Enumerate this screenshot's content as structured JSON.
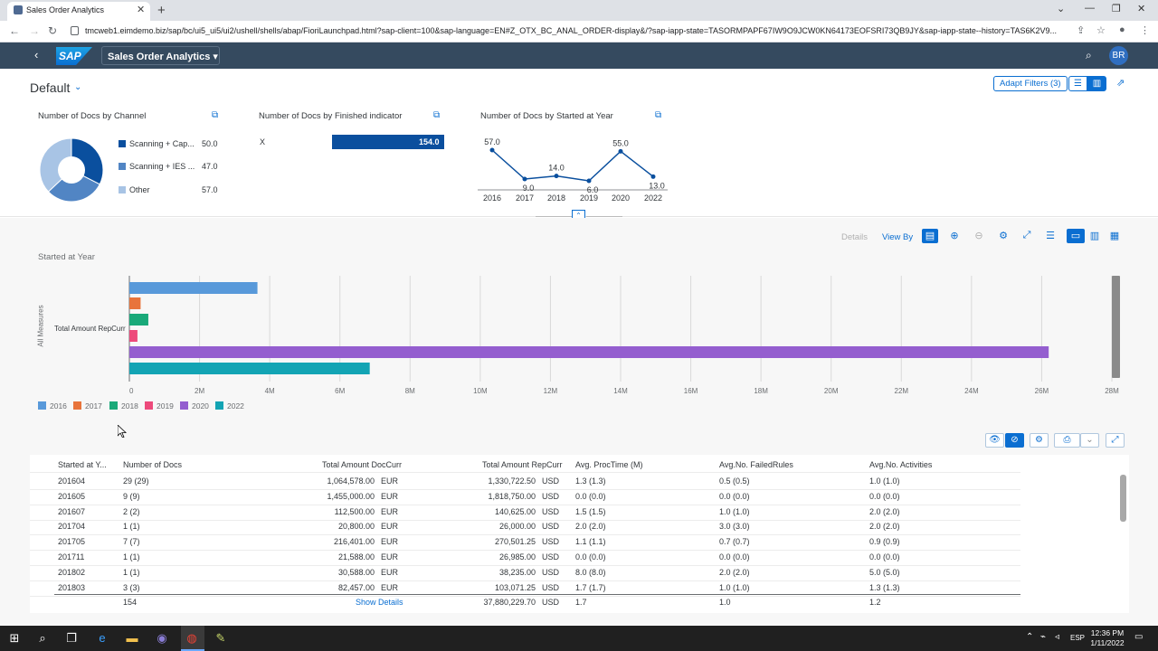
{
  "browser": {
    "tab_title": "Sales Order Analytics",
    "url": "tmcweb1.eimdemo.biz/sap/bc/ui5_ui5/ui2/ushell/shells/abap/FioriLaunchpad.html?sap-client=100&sap-language=EN#Z_OTX_BC_ANAL_ORDER-display&/?sap-iapp-state=TASORMPAPF67IW9O9JCW0KN64173EOFSRI73QB9JY&sap-iapp-state--history=TAS6K2V9..."
  },
  "shell": {
    "logo": "SAP",
    "app_title": "Sales Order Analytics ▾",
    "avatar": "BR"
  },
  "header": {
    "variant": "Default",
    "adapt_filters": "Adapt Filters (3)"
  },
  "cards": {
    "channel": {
      "title": "Number of Docs by Channel",
      "legend": [
        {
          "label": "Scanning + Cap...",
          "value": "50.0",
          "color": "#0a4f9e"
        },
        {
          "label": "Scanning + IES ...",
          "value": "47.0",
          "color": "#5185c4"
        },
        {
          "label": "Other",
          "value": "57.0",
          "color": "#a8c4e5"
        }
      ]
    },
    "finished": {
      "title": "Number of Docs by Finished indicator",
      "category": "X",
      "value": "154.0"
    },
    "started": {
      "title": "Number of Docs by Started at Year",
      "points": [
        {
          "year": "2016",
          "value": 57,
          "label": "57.0"
        },
        {
          "year": "2017",
          "value": 9,
          "label": "9.0"
        },
        {
          "year": "2018",
          "value": 14,
          "label": "14.0"
        },
        {
          "year": "2019",
          "value": 6,
          "label": "6.0"
        },
        {
          "year": "2020",
          "value": 55,
          "label": "55.0"
        },
        {
          "year": "2022",
          "value": 13,
          "label": "13.0"
        }
      ]
    }
  },
  "toolbar": {
    "details": "Details",
    "view_by": "View By"
  },
  "chart_data": {
    "type": "bar",
    "title": "Started at Year",
    "ylabel": "All Measures",
    "category": "Total Amount RepCurr",
    "xlim": [
      0,
      28000000
    ],
    "ticks": [
      "0",
      "2M",
      "4M",
      "6M",
      "8M",
      "10M",
      "12M",
      "14M",
      "16M",
      "18M",
      "20M",
      "22M",
      "24M",
      "26M",
      "28M"
    ],
    "series": [
      {
        "name": "2016",
        "value": 3650000,
        "color": "#5899da"
      },
      {
        "name": "2017",
        "value": 320000,
        "color": "#e8743b"
      },
      {
        "name": "2018",
        "value": 540000,
        "color": "#19a979"
      },
      {
        "name": "2019",
        "value": 230000,
        "color": "#ed4a7b"
      },
      {
        "name": "2020",
        "value": 26200000,
        "color": "#945ecf"
      },
      {
        "name": "2022",
        "value": 6850000,
        "color": "#13a4b4"
      }
    ]
  },
  "table": {
    "columns": [
      "Started at Y...",
      "Number of Docs",
      "Total Amount DocCurr",
      "Total Amount RepCurr",
      "Avg. ProcTime (M)",
      "Avg.No. FailedRules",
      "Avg.No. Activities"
    ],
    "rows": [
      [
        "201604",
        "29 (29)",
        "1,064,578.00",
        "EUR",
        "1,330,722.50",
        "USD",
        "1.3 (1.3)",
        "0.5 (0.5)",
        "1.0 (1.0)"
      ],
      [
        "201605",
        "9 (9)",
        "1,455,000.00",
        "EUR",
        "1,818,750.00",
        "USD",
        "0.0 (0.0)",
        "0.0 (0.0)",
        "0.0 (0.0)"
      ],
      [
        "201607",
        "2 (2)",
        "112,500.00",
        "EUR",
        "140,625.00",
        "USD",
        "1.5 (1.5)",
        "1.0 (1.0)",
        "2.0 (2.0)"
      ],
      [
        "201704",
        "1 (1)",
        "20,800.00",
        "EUR",
        "26,000.00",
        "USD",
        "2.0 (2.0)",
        "3.0 (3.0)",
        "2.0 (2.0)"
      ],
      [
        "201705",
        "7 (7)",
        "216,401.00",
        "EUR",
        "270,501.25",
        "USD",
        "1.1 (1.1)",
        "0.7 (0.7)",
        "0.9 (0.9)"
      ],
      [
        "201711",
        "1 (1)",
        "21,588.00",
        "EUR",
        "26,985.00",
        "USD",
        "0.0 (0.0)",
        "0.0 (0.0)",
        "0.0 (0.0)"
      ],
      [
        "201802",
        "1 (1)",
        "30,588.00",
        "EUR",
        "38,235.00",
        "USD",
        "8.0 (8.0)",
        "2.0 (2.0)",
        "5.0 (5.0)"
      ],
      [
        "201803",
        "3 (3)",
        "82,457.00",
        "EUR",
        "103,071.25",
        "USD",
        "1.7 (1.7)",
        "1.0 (1.0)",
        "1.3 (1.3)"
      ]
    ],
    "totals": {
      "docs": "154",
      "show_details": "Show Details",
      "rep": "37,880,229.70",
      "cur": "USD",
      "proc": "1.7",
      "failed": "1.0",
      "acts": "1.2"
    }
  },
  "taskbar": {
    "lang": "ESP",
    "time": "12:36 PM",
    "date": "1/11/2022"
  }
}
